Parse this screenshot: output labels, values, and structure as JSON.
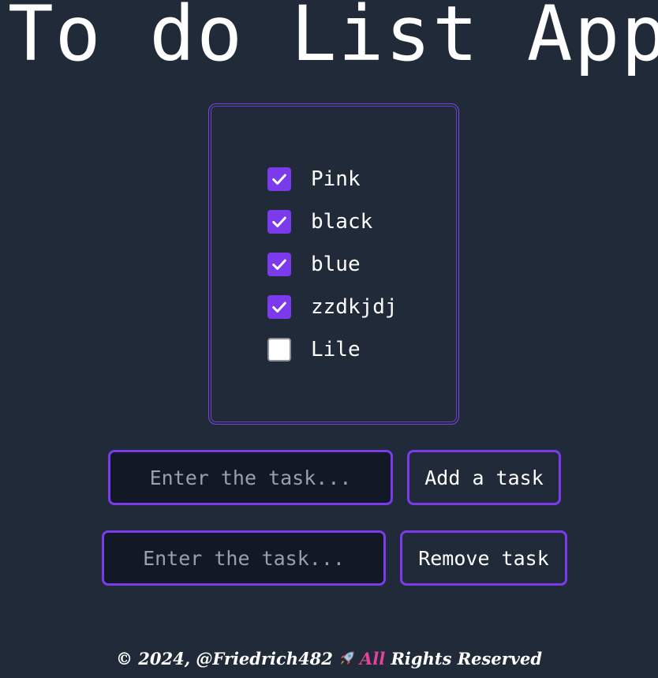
{
  "app": {
    "title": "To do List App"
  },
  "task_list": {
    "items": [
      {
        "label": "Pink",
        "checked": true
      },
      {
        "label": "black",
        "checked": true
      },
      {
        "label": "blue",
        "checked": true
      },
      {
        "label": "zzdkjdj",
        "checked": true
      },
      {
        "label": "Lile",
        "checked": false
      }
    ]
  },
  "add_task": {
    "input_value": "",
    "input_placeholder": "Enter the task...",
    "button_label": "Add a task"
  },
  "remove_task": {
    "input_value": "",
    "input_placeholder": "Enter the task...",
    "button_label": "Remove task"
  },
  "footer": {
    "copyright": "© 2024, @Friedrich482",
    "icon": "rocket-icon",
    "highlight": "All",
    "rest": " Rights Reserved"
  },
  "colors": {
    "background": "#212a38",
    "accent": "#7c3aed",
    "checkbox_checked": "#7c3aed",
    "footer_highlight": "#e0449a",
    "input_background": "#111826"
  }
}
